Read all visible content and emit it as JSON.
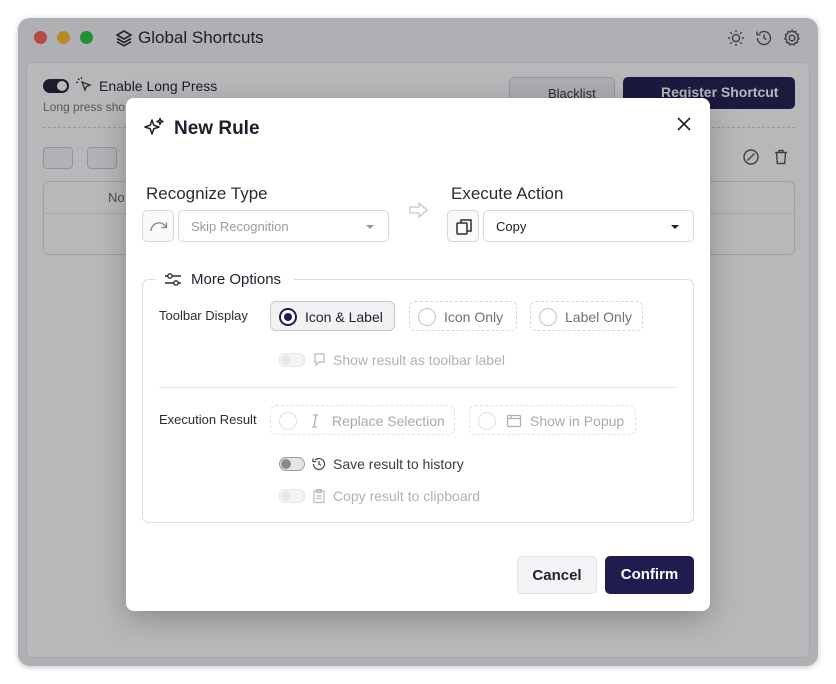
{
  "window": {
    "title": "Global Shortcuts",
    "title_icons": [
      "sun-icon",
      "history-icon",
      "gear-icon"
    ]
  },
  "background": {
    "long_press_label": "Enable Long Press",
    "long_press_sub": "Long press sho",
    "blacklist_label": "Blacklist",
    "register_label": "Register Shortcut",
    "card_text": "No"
  },
  "dialog": {
    "title": "New Rule",
    "recognize": {
      "label": "Recognize Type",
      "value": "Skip Recognition"
    },
    "execute": {
      "label": "Execute Action",
      "value": "Copy"
    },
    "more_options": {
      "title": "More Options",
      "toolbar_display": {
        "label": "Toolbar Display",
        "options": [
          "Icon & Label",
          "Icon Only",
          "Label Only"
        ],
        "selected": "Icon & Label"
      },
      "show_result_label": "Show result as toolbar label",
      "execution_result": {
        "label": "Execution Result",
        "options": [
          "Replace Selection",
          "Show in Popup"
        ]
      },
      "save_history_label": "Save result to history",
      "copy_clipboard_label": "Copy result to clipboard"
    },
    "cancel_label": "Cancel",
    "confirm_label": "Confirm"
  },
  "colors": {
    "accent": "#1f1d4f",
    "overlay": "rgba(20,20,28,0.30)"
  }
}
